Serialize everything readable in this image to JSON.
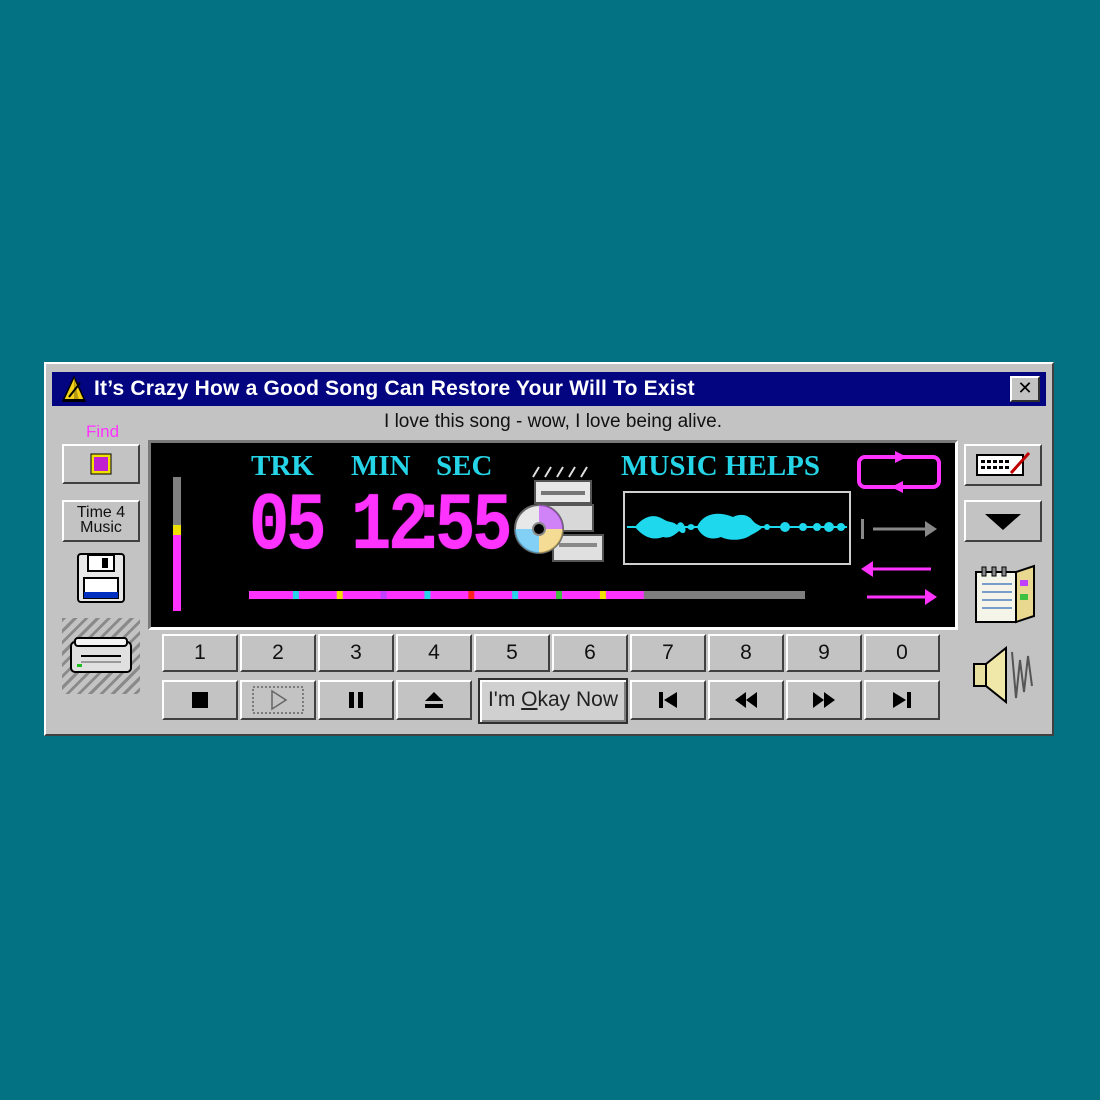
{
  "window": {
    "title": "It’s Crazy How a Good Song Can Restore Your Will To Exist",
    "close_label": "✕"
  },
  "status_text": "I love this song - wow, I love being alive.",
  "left_panel": {
    "find_label": "Find",
    "time4music_line1": "Time 4",
    "time4music_line2": "Music"
  },
  "display": {
    "trk_label": "TRK",
    "min_label": "MIN",
    "sec_label": "SEC",
    "track": "05",
    "minutes": "12",
    "seconds": "55",
    "time_separator": ":",
    "brand": "MUSIC HELPS",
    "volume_level": 0.6,
    "progress_fraction": 0.71
  },
  "track_buttons": [
    "1",
    "2",
    "3",
    "4",
    "5",
    "6",
    "7",
    "8",
    "9",
    "0"
  ],
  "controls": {
    "okay_prefix": "I'm ",
    "okay_underlined": "O",
    "okay_suffix": "kay Now"
  },
  "icons": {
    "title": "metronome-icon",
    "find": "find-square-icon",
    "save": "floppy-disk-icon",
    "drive": "disk-drive-icon",
    "cd": "cd-computer-icon",
    "repeat": "repeat-icon",
    "edit_playlist": "edit-playlist-icon",
    "dropdown": "triangle-down-icon",
    "notebook": "notebook-icon",
    "speaker": "speaker-icon"
  },
  "colors": {
    "desktop": "#037383",
    "titlebar": "#03047f",
    "display_text_cyan": "#25d4e6",
    "display_digits_magenta": "#ff33ff"
  }
}
